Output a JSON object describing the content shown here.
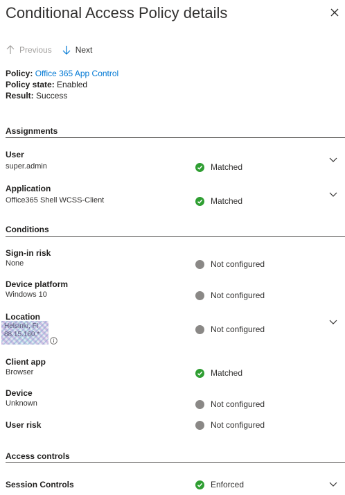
{
  "panel": {
    "title": "Conditional Access Policy details",
    "nav": {
      "previous": "Previous",
      "next": "Next"
    }
  },
  "meta": {
    "policy_label": "Policy:",
    "policy_value": "Office 365 App Control",
    "state_label": "Policy state:",
    "state_value": "Enabled",
    "result_label": "Result:",
    "result_value": "Success"
  },
  "sections": {
    "assignments": "Assignments",
    "conditions": "Conditions",
    "access_controls": "Access controls"
  },
  "assignments": {
    "user": {
      "label": "User",
      "value": "super.admin",
      "status": "Matched"
    },
    "application": {
      "label": "Application",
      "value": "Office365 Shell WCSS-Client",
      "status": "Matched"
    }
  },
  "conditions": {
    "signin_risk": {
      "label": "Sign-in risk",
      "value": "None",
      "status": "Not configured"
    },
    "device_platform": {
      "label": "Device platform",
      "value": "Windows 10",
      "status": "Not configured"
    },
    "location": {
      "label": "Location",
      "value_line1": "Helsinki, FI",
      "value_line2": "88.15.160.*",
      "status": "Not configured"
    },
    "client_app": {
      "label": "Client app",
      "value": "Browser",
      "status": "Matched"
    },
    "device": {
      "label": "Device",
      "value": "Unknown",
      "status": "Not configured"
    },
    "user_risk": {
      "label": "User risk",
      "status": "Not configured"
    }
  },
  "access_controls": {
    "session_controls": {
      "label": "Session Controls",
      "status": "Enforced"
    }
  },
  "colors": {
    "matched": "#2f9e32",
    "not_configured": "#8a8886",
    "link": "#0078d4"
  }
}
